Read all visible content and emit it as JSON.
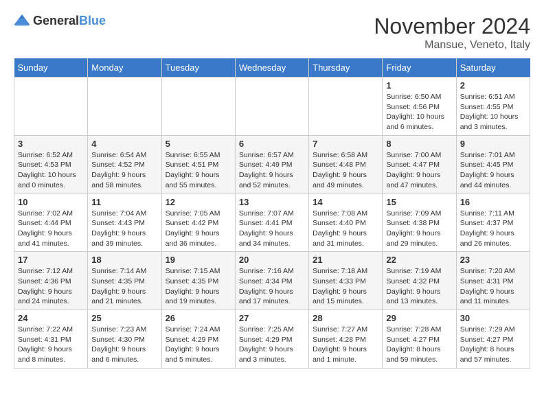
{
  "logo": {
    "general": "General",
    "blue": "Blue"
  },
  "header": {
    "month_title": "November 2024",
    "location": "Mansue, Veneto, Italy"
  },
  "weekdays": [
    "Sunday",
    "Monday",
    "Tuesday",
    "Wednesday",
    "Thursday",
    "Friday",
    "Saturday"
  ],
  "weeks": [
    [
      {
        "day": "",
        "info": ""
      },
      {
        "day": "",
        "info": ""
      },
      {
        "day": "",
        "info": ""
      },
      {
        "day": "",
        "info": ""
      },
      {
        "day": "",
        "info": ""
      },
      {
        "day": "1",
        "info": "Sunrise: 6:50 AM\nSunset: 4:56 PM\nDaylight: 10 hours and 6 minutes."
      },
      {
        "day": "2",
        "info": "Sunrise: 6:51 AM\nSunset: 4:55 PM\nDaylight: 10 hours and 3 minutes."
      }
    ],
    [
      {
        "day": "3",
        "info": "Sunrise: 6:52 AM\nSunset: 4:53 PM\nDaylight: 10 hours and 0 minutes."
      },
      {
        "day": "4",
        "info": "Sunrise: 6:54 AM\nSunset: 4:52 PM\nDaylight: 9 hours and 58 minutes."
      },
      {
        "day": "5",
        "info": "Sunrise: 6:55 AM\nSunset: 4:51 PM\nDaylight: 9 hours and 55 minutes."
      },
      {
        "day": "6",
        "info": "Sunrise: 6:57 AM\nSunset: 4:49 PM\nDaylight: 9 hours and 52 minutes."
      },
      {
        "day": "7",
        "info": "Sunrise: 6:58 AM\nSunset: 4:48 PM\nDaylight: 9 hours and 49 minutes."
      },
      {
        "day": "8",
        "info": "Sunrise: 7:00 AM\nSunset: 4:47 PM\nDaylight: 9 hours and 47 minutes."
      },
      {
        "day": "9",
        "info": "Sunrise: 7:01 AM\nSunset: 4:45 PM\nDaylight: 9 hours and 44 minutes."
      }
    ],
    [
      {
        "day": "10",
        "info": "Sunrise: 7:02 AM\nSunset: 4:44 PM\nDaylight: 9 hours and 41 minutes."
      },
      {
        "day": "11",
        "info": "Sunrise: 7:04 AM\nSunset: 4:43 PM\nDaylight: 9 hours and 39 minutes."
      },
      {
        "day": "12",
        "info": "Sunrise: 7:05 AM\nSunset: 4:42 PM\nDaylight: 9 hours and 36 minutes."
      },
      {
        "day": "13",
        "info": "Sunrise: 7:07 AM\nSunset: 4:41 PM\nDaylight: 9 hours and 34 minutes."
      },
      {
        "day": "14",
        "info": "Sunrise: 7:08 AM\nSunset: 4:40 PM\nDaylight: 9 hours and 31 minutes."
      },
      {
        "day": "15",
        "info": "Sunrise: 7:09 AM\nSunset: 4:38 PM\nDaylight: 9 hours and 29 minutes."
      },
      {
        "day": "16",
        "info": "Sunrise: 7:11 AM\nSunset: 4:37 PM\nDaylight: 9 hours and 26 minutes."
      }
    ],
    [
      {
        "day": "17",
        "info": "Sunrise: 7:12 AM\nSunset: 4:36 PM\nDaylight: 9 hours and 24 minutes."
      },
      {
        "day": "18",
        "info": "Sunrise: 7:14 AM\nSunset: 4:35 PM\nDaylight: 9 hours and 21 minutes."
      },
      {
        "day": "19",
        "info": "Sunrise: 7:15 AM\nSunset: 4:35 PM\nDaylight: 9 hours and 19 minutes."
      },
      {
        "day": "20",
        "info": "Sunrise: 7:16 AM\nSunset: 4:34 PM\nDaylight: 9 hours and 17 minutes."
      },
      {
        "day": "21",
        "info": "Sunrise: 7:18 AM\nSunset: 4:33 PM\nDaylight: 9 hours and 15 minutes."
      },
      {
        "day": "22",
        "info": "Sunrise: 7:19 AM\nSunset: 4:32 PM\nDaylight: 9 hours and 13 minutes."
      },
      {
        "day": "23",
        "info": "Sunrise: 7:20 AM\nSunset: 4:31 PM\nDaylight: 9 hours and 11 minutes."
      }
    ],
    [
      {
        "day": "24",
        "info": "Sunrise: 7:22 AM\nSunset: 4:31 PM\nDaylight: 9 hours and 8 minutes."
      },
      {
        "day": "25",
        "info": "Sunrise: 7:23 AM\nSunset: 4:30 PM\nDaylight: 9 hours and 6 minutes."
      },
      {
        "day": "26",
        "info": "Sunrise: 7:24 AM\nSunset: 4:29 PM\nDaylight: 9 hours and 5 minutes."
      },
      {
        "day": "27",
        "info": "Sunrise: 7:25 AM\nSunset: 4:29 PM\nDaylight: 9 hours and 3 minutes."
      },
      {
        "day": "28",
        "info": "Sunrise: 7:27 AM\nSunset: 4:28 PM\nDaylight: 9 hours and 1 minute."
      },
      {
        "day": "29",
        "info": "Sunrise: 7:28 AM\nSunset: 4:27 PM\nDaylight: 8 hours and 59 minutes."
      },
      {
        "day": "30",
        "info": "Sunrise: 7:29 AM\nSunset: 4:27 PM\nDaylight: 8 hours and 57 minutes."
      }
    ]
  ]
}
